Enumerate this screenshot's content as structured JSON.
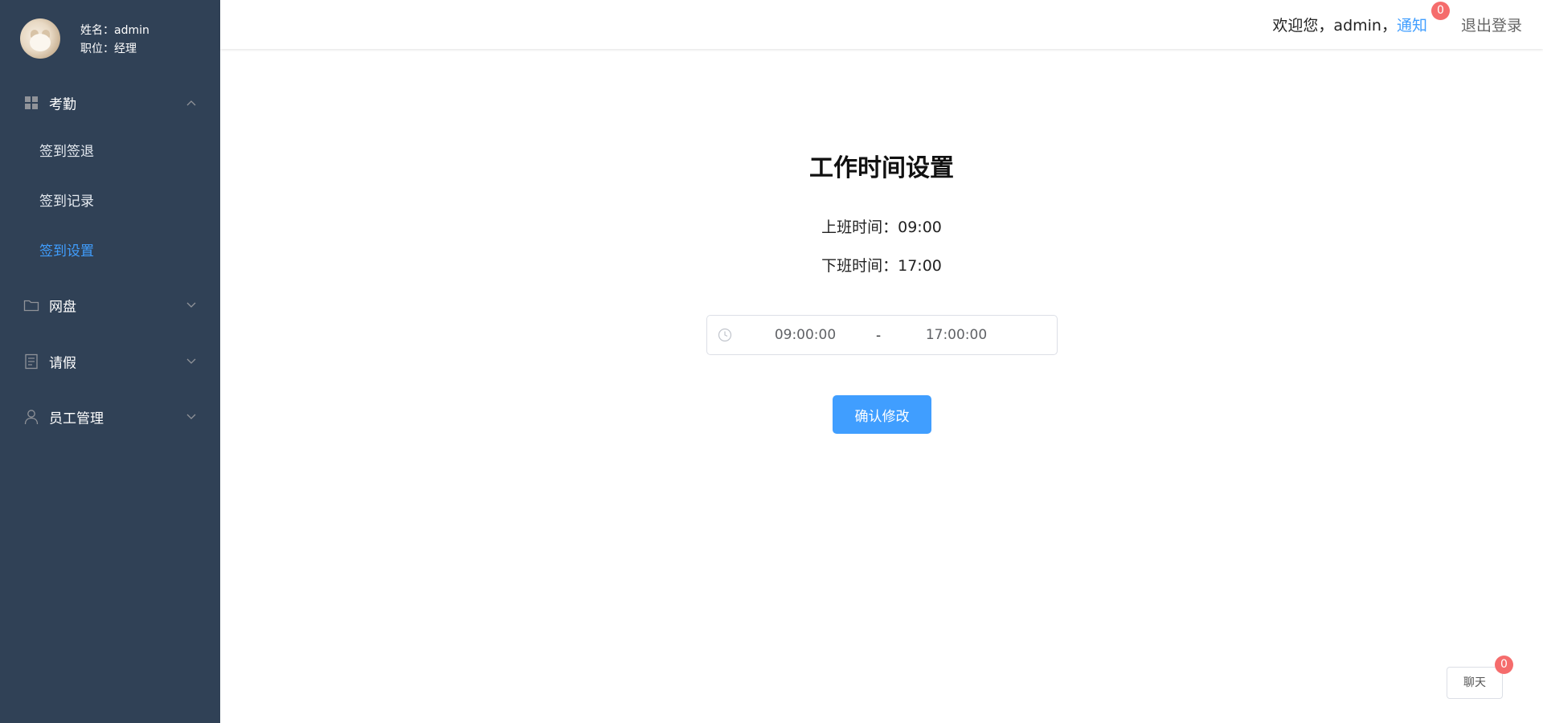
{
  "profile": {
    "name_line": "姓名：admin",
    "position_line": "职位：经理"
  },
  "sidebar": {
    "groups": [
      {
        "label": "考勤",
        "icon": "grid-icon",
        "expanded": true,
        "items": [
          {
            "label": "签到签退"
          },
          {
            "label": "签到记录"
          },
          {
            "label": "签到设置",
            "active": true
          }
        ]
      },
      {
        "label": "网盘",
        "icon": "folder-icon",
        "expanded": false
      },
      {
        "label": "请假",
        "icon": "document-icon",
        "expanded": false
      },
      {
        "label": "员工管理",
        "icon": "user-icon",
        "expanded": false
      }
    ]
  },
  "header": {
    "welcome": "欢迎您，admin，",
    "notify_label": "通知",
    "notify_count": "0",
    "logout_label": "退出登录"
  },
  "main": {
    "title": "工作时间设置",
    "start_time_text": "上班时间：09:00",
    "end_time_text": "下班时间：17:00",
    "range": {
      "start": "09:00:00",
      "separator": "-",
      "end": "17:00:00"
    },
    "confirm_label": "确认修改"
  },
  "chat": {
    "label": "聊天",
    "count": "0"
  },
  "colors": {
    "sidebar_bg": "#304156",
    "accent": "#409eff",
    "badge": "#f56c6c"
  }
}
